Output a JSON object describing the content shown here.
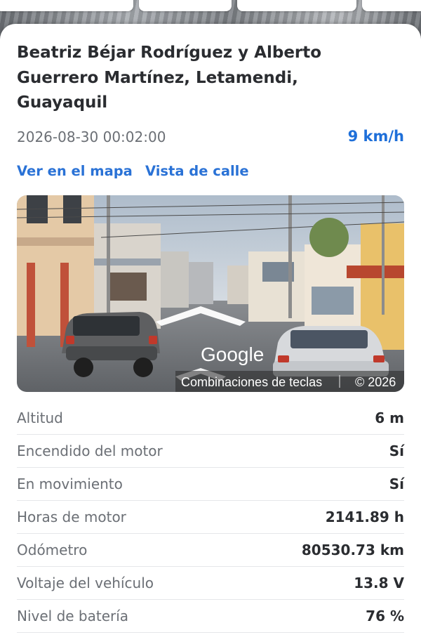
{
  "location": {
    "title": "Beatriz Béjar Rodríguez y Alberto Guerrero Martínez, Letamendi, Guayaquil",
    "timestamp": "2026-08-30 00:02:00",
    "speed": "9 km/h"
  },
  "links": {
    "map": "Ver en el mapa",
    "street_view": "Vista de calle"
  },
  "street_view": {
    "logo": "Google",
    "shortcuts": "Combinaciones de teclas",
    "copyright": "© 2026"
  },
  "details": [
    {
      "label": "Altitud",
      "value": "6 m"
    },
    {
      "label": "Encendido del motor",
      "value": "Sí"
    },
    {
      "label": "En movimiento",
      "value": "Sí"
    },
    {
      "label": "Horas de motor",
      "value": "2141.89 h"
    },
    {
      "label": "Odómetro",
      "value": "80530.73 km"
    },
    {
      "label": "Voltaje del vehículo",
      "value": "13.8 V"
    },
    {
      "label": "Nivel de batería",
      "value": "76 %"
    }
  ],
  "colors": {
    "accent": "#1e6fd9",
    "link": "#2a72d6",
    "text_primary": "#2a2c30",
    "text_secondary": "#6b6f75"
  }
}
